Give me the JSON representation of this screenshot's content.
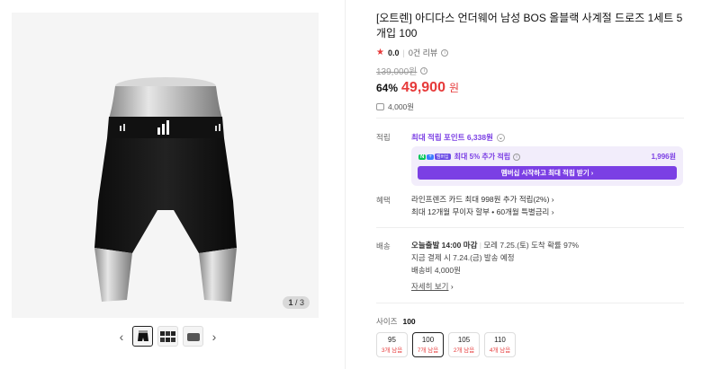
{
  "product": {
    "title": "[오트렌] 아디다스 언더웨어 남성 BOS 올블랙 사계절 드로즈 1세트 5개입 100",
    "rating": "0.0",
    "reviews": "0건 리뷰",
    "original_price": "139,000원",
    "discount": "64%",
    "price": "49,900",
    "currency": "원",
    "points": "4,000원"
  },
  "gallery": {
    "page_current": "1",
    "page_total": "3",
    "prev_icon": "chevron-left-icon",
    "next_icon": "chevron-right-icon"
  },
  "benefits": {
    "label": "적립",
    "max_points": "최대 적립 포인트 6,338원",
    "membership_text": "최대 5% 추가 적립",
    "membership_amount": "1,996원",
    "membership_button": "멤버십 시작하고 최대 적립 받기 ›"
  },
  "perks": {
    "label": "혜택",
    "card": "라인프렌즈 카드 최대 998원 추가 적립(2%)",
    "installment": "최대 12개월 무이자 할부 • 60개월 특별금리"
  },
  "shipping": {
    "label": "배송",
    "deadline": "오늘출발 14:00 마감",
    "arrival": "모레 7.25.(토) 도착 확률 97%",
    "dispatch": "지금 결제 시 7.24.(금) 발송 예정",
    "fee": "배송비 4,000원",
    "details": "자세히 보기"
  },
  "size": {
    "label": "사이즈",
    "selected": "100",
    "options": [
      {
        "size": "95",
        "stock": "3개 남음"
      },
      {
        "size": "100",
        "stock": "7개 남음"
      },
      {
        "size": "105",
        "stock": "2개 남음"
      },
      {
        "size": "110",
        "stock": "4개 남음"
      }
    ]
  },
  "colors": {
    "accent_red": "#e63a3a",
    "accent_purple": "#7b3fe4"
  }
}
